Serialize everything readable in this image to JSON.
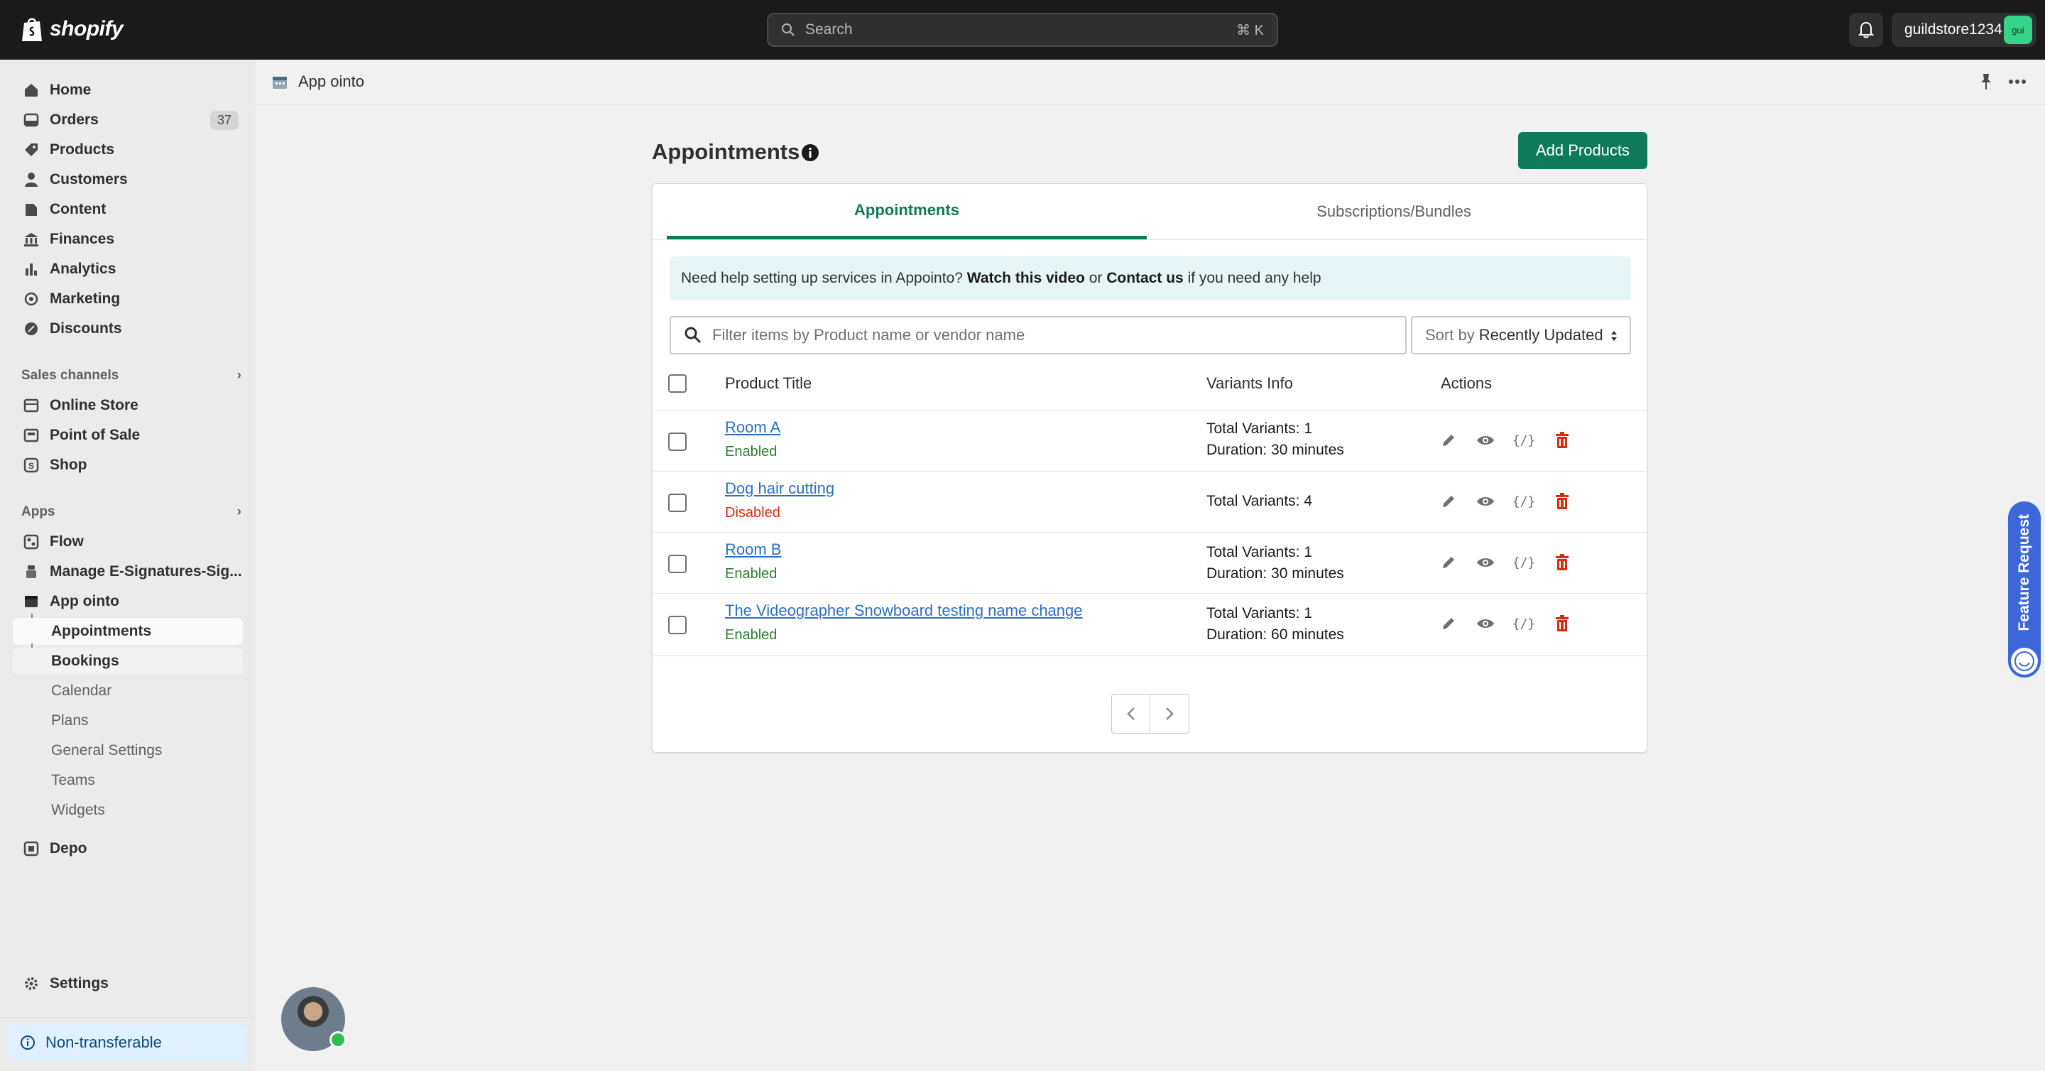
{
  "topbar": {
    "logo_text": "shopify",
    "search_placeholder": "Search",
    "search_shortcut": "⌘ K",
    "store_name": "guildstore1234",
    "store_avatar": "gui"
  },
  "sidebar": {
    "main_items": [
      {
        "label": "Home",
        "icon": "home-icon"
      },
      {
        "label": "Orders",
        "icon": "orders-icon",
        "badge": "37"
      },
      {
        "label": "Products",
        "icon": "tag-icon"
      },
      {
        "label": "Customers",
        "icon": "person-icon"
      },
      {
        "label": "Content",
        "icon": "content-icon"
      },
      {
        "label": "Finances",
        "icon": "bank-icon"
      },
      {
        "label": "Analytics",
        "icon": "chart-icon"
      },
      {
        "label": "Marketing",
        "icon": "target-icon"
      },
      {
        "label": "Discounts",
        "icon": "discount-icon"
      }
    ],
    "sales_channels_label": "Sales channels",
    "sales_channels": [
      {
        "label": "Online Store",
        "icon": "store-icon"
      },
      {
        "label": "Point of Sale",
        "icon": "pos-icon"
      },
      {
        "label": "Shop",
        "icon": "shop-icon"
      }
    ],
    "apps_label": "Apps",
    "apps": [
      {
        "label": "Flow",
        "icon": "flow-icon"
      },
      {
        "label": "Manage E-Signatures-Sig...",
        "icon": "signature-icon"
      },
      {
        "label": "App ointo",
        "icon": "appointo-icon"
      }
    ],
    "app_sub_items": [
      "Appointments",
      "Bookings",
      "Calendar",
      "Plans",
      "General Settings",
      "Teams",
      "Widgets"
    ],
    "depo": "Depo",
    "settings": "Settings",
    "non_transferable": "Non-transferable"
  },
  "app_header": {
    "title": "App ointo"
  },
  "main": {
    "page_title": "Appointments",
    "add_button": "Add Products",
    "tabs": [
      "Appointments",
      "Subscriptions/Bundles"
    ],
    "help": {
      "prefix": "Need help setting up services in Appointo?",
      "link1": "Watch this video",
      "middle": "or",
      "link2": "Contact us",
      "suffix": "if you need any help"
    },
    "filter_placeholder": "Filter items by Product name or vendor name",
    "sort_label": "Sort by",
    "sort_value": "Recently Updated",
    "columns": [
      "Product Title",
      "Variants Info",
      "Actions"
    ],
    "rows": [
      {
        "title": "Room A",
        "status": "Enabled",
        "variants": "Total Variants: 1",
        "duration": "Duration: 30 minutes"
      },
      {
        "title": "Dog hair cutting",
        "status": "Disabled",
        "variants": "Total Variants: 4",
        "duration": ""
      },
      {
        "title": "Room B",
        "status": "Enabled",
        "variants": "Total Variants: 1",
        "duration": "Duration: 30 minutes"
      },
      {
        "title": "The Videographer Snowboard testing name change",
        "status": "Enabled",
        "variants": "Total Variants: 1",
        "duration": "Duration: 60 minutes"
      }
    ]
  },
  "feature_request": "Feature Request",
  "colors": {
    "brand_green": "#0e7a5a",
    "link_blue": "#2c6ecb",
    "disabled_red": "#d82c0d",
    "enabled_green": "#2e7d32"
  }
}
